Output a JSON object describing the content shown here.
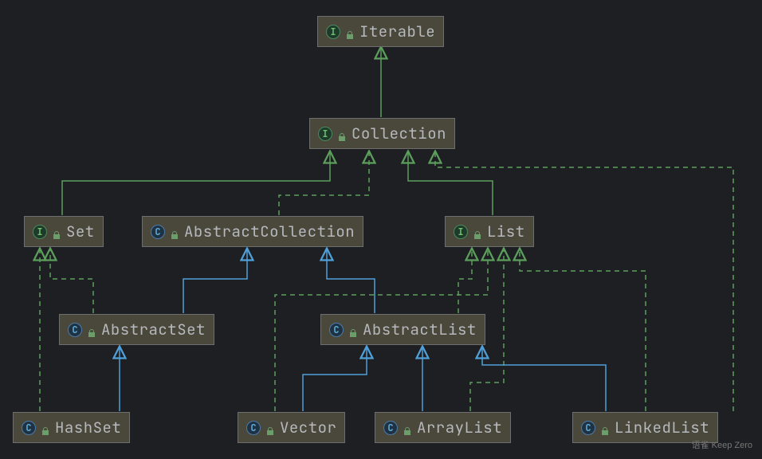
{
  "nodes": {
    "iterable": {
      "label": "Iterable",
      "kind": "I"
    },
    "collection": {
      "label": "Collection",
      "kind": "I"
    },
    "set": {
      "label": "Set",
      "kind": "I"
    },
    "abstractCollection": {
      "label": "AbstractCollection",
      "kind": "C"
    },
    "list": {
      "label": "List",
      "kind": "I"
    },
    "abstractSet": {
      "label": "AbstractSet",
      "kind": "C"
    },
    "abstractList": {
      "label": "AbstractList",
      "kind": "C"
    },
    "hashSet": {
      "label": "HashSet",
      "kind": "C"
    },
    "vector": {
      "label": "Vector",
      "kind": "C"
    },
    "arrayList": {
      "label": "ArrayList",
      "kind": "C"
    },
    "linkedList": {
      "label": "LinkedList",
      "kind": "C"
    }
  },
  "edges": [
    {
      "from": "collection",
      "to": "iterable",
      "style": "extends-solid"
    },
    {
      "from": "set",
      "to": "collection",
      "style": "extends-solid"
    },
    {
      "from": "abstractCollection",
      "to": "collection",
      "style": "implements-dashed"
    },
    {
      "from": "list",
      "to": "collection",
      "style": "extends-solid"
    },
    {
      "from": "abstractSet",
      "to": "set",
      "style": "implements-dashed"
    },
    {
      "from": "abstractSet",
      "to": "abstractCollection",
      "style": "extends-class"
    },
    {
      "from": "abstractList",
      "to": "abstractCollection",
      "style": "extends-class"
    },
    {
      "from": "abstractList",
      "to": "list",
      "style": "implements-dashed"
    },
    {
      "from": "hashSet",
      "to": "set",
      "style": "implements-dashed"
    },
    {
      "from": "hashSet",
      "to": "abstractSet",
      "style": "extends-class"
    },
    {
      "from": "vector",
      "to": "abstractList",
      "style": "extends-class"
    },
    {
      "from": "vector",
      "to": "list",
      "style": "implements-dashed"
    },
    {
      "from": "arrayList",
      "to": "abstractList",
      "style": "extends-class"
    },
    {
      "from": "arrayList",
      "to": "list",
      "style": "implements-dashed"
    },
    {
      "from": "linkedList",
      "to": "abstractList",
      "style": "extends-class"
    },
    {
      "from": "linkedList",
      "to": "list",
      "style": "implements-dashed"
    },
    {
      "from": "linkedList",
      "to": "collection",
      "style": "implements-dashed"
    }
  ],
  "watermark": "语雀 Keep Zero",
  "colors": {
    "extendsSolid": "#5c9e5c",
    "implementsDashed": "#5c9e5c",
    "extendsClass": "#4f9fd8",
    "bg": "#1e1f22",
    "nodeBg": "#4a473b"
  }
}
